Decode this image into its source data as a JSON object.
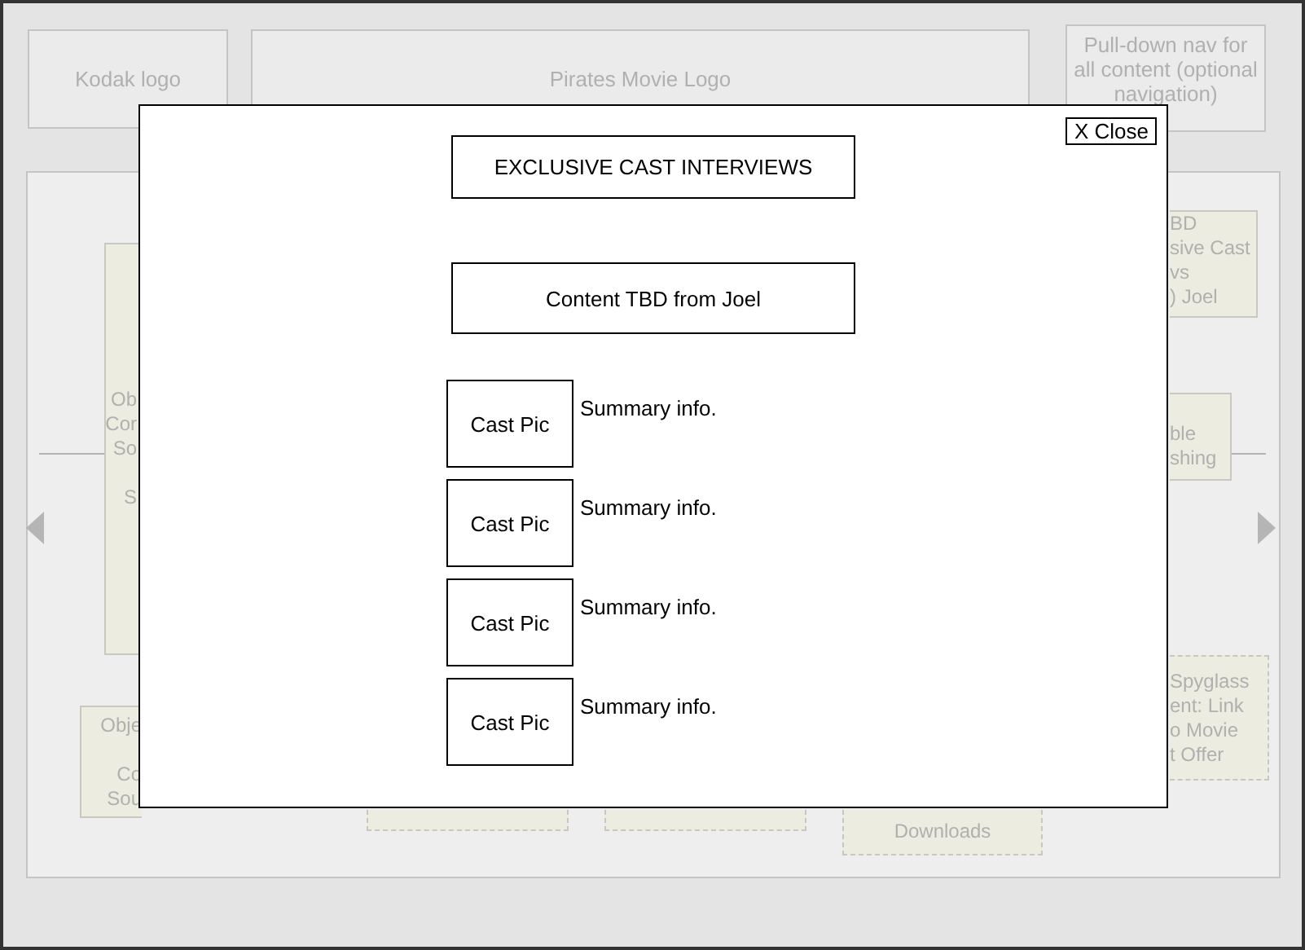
{
  "header": {
    "logo": "Kodak logo",
    "title": "Pirates Movie Logo",
    "nav_note": [
      "Pull-down nav for",
      "all content (optional",
      "navigation)"
    ]
  },
  "notes": [
    {
      "dashed": false,
      "paragraphs": [
        [
          "Ob",
          "Cor",
          "So"
        ],
        [
          "S"
        ]
      ]
    },
    {
      "dashed": false,
      "paragraphs": [
        [
          "Obje"
        ],
        [
          "Co",
          "Sou"
        ]
      ]
    },
    {
      "dashed": false,
      "paragraphs": [
        [
          "BD",
          "sive Cast",
          "vs",
          ") Joel"
        ]
      ]
    },
    {
      "dashed": false,
      "paragraphs": [
        [
          "ble",
          "shing"
        ]
      ]
    },
    {
      "dashed": true,
      "paragraphs": [
        [
          "Spyglass",
          "ent: Link",
          "o Movie",
          "t Offer"
        ]
      ]
    },
    {
      "dashed": true
    },
    {
      "dashed": true
    },
    {
      "dashed": true,
      "paragraphs": [
        [
          "Downloads"
        ]
      ]
    }
  ],
  "modal": {
    "close": "X Close",
    "title": "EXCLUSIVE CAST INTERVIEWS",
    "content_note": "Content TBD from Joel",
    "cast": [
      {
        "pic": "Cast Pic",
        "summary": "Summary info."
      },
      {
        "pic": "Cast Pic",
        "summary": "Summary info."
      },
      {
        "pic": "Cast Pic",
        "summary": "Summary info."
      },
      {
        "pic": "Cast Pic",
        "summary": "Summary info."
      }
    ]
  }
}
